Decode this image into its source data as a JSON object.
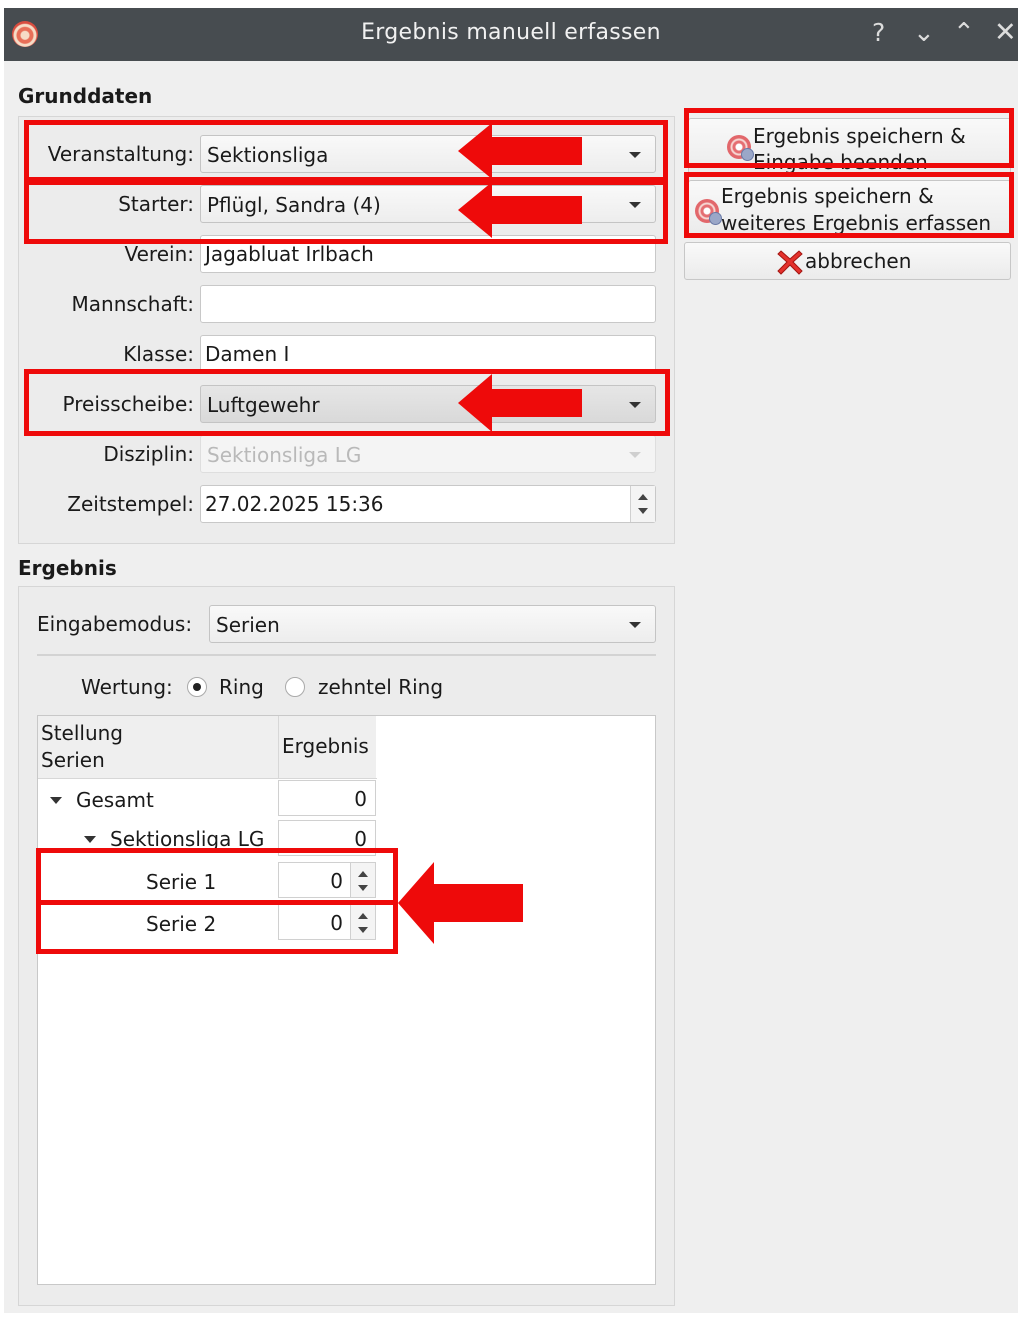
{
  "window": {
    "title": "Ergebnis manuell erfassen",
    "controls": {
      "help": "?",
      "minimize": "⌄",
      "maximize": "⌃",
      "close": "✕"
    }
  },
  "grunddaten": {
    "section_title": "Grunddaten",
    "veranstaltung": {
      "label": "Veranstaltung:",
      "value": "Sektionsliga"
    },
    "starter": {
      "label": "Starter:",
      "value": "Pflügl, Sandra (4)"
    },
    "verein": {
      "label": "Verein:",
      "value": "Jagabluat Irlbach"
    },
    "mannschaft": {
      "label": "Mannschaft:",
      "value": ""
    },
    "klasse": {
      "label": "Klasse:",
      "value": "Damen I"
    },
    "preisscheibe": {
      "label": "Preisscheibe:",
      "value": "Luftgewehr"
    },
    "disziplin": {
      "label": "Disziplin:",
      "value": "Sektionsliga LG"
    },
    "zeitstempel": {
      "label": "Zeitstempel:",
      "value": "27.02.2025 15:36"
    }
  },
  "buttons": {
    "save_finish": {
      "line1": "Ergebnis speichern &",
      "line2": "Eingabe beenden"
    },
    "save_next": {
      "line1": "Ergebnis speichern &",
      "line2": "weiteres Ergebnis erfassen"
    },
    "cancel": {
      "label": "abbrechen"
    }
  },
  "ergebnis": {
    "section_title": "Ergebnis",
    "eingabemodus": {
      "label": "Eingabemodus:",
      "value": "Serien"
    },
    "wertung": {
      "label": "Wertung:",
      "options": [
        {
          "label": "Ring",
          "checked": true
        },
        {
          "label": "zehntel Ring",
          "checked": false
        }
      ]
    },
    "tree": {
      "headers": {
        "col1_line1": "Stellung",
        "col1_line2": "Serien",
        "col2": "Ergebnis"
      },
      "rows": [
        {
          "label": "Gesamt",
          "value": "0"
        },
        {
          "label": "Sektionsliga LG",
          "value": "0"
        },
        {
          "label": "Serie 1",
          "value": "0"
        },
        {
          "label": "Serie 2",
          "value": "0"
        }
      ]
    }
  },
  "colors": {
    "highlight": "#ee0a0a",
    "titlebar": "#474c50",
    "window_bg": "#efefef"
  }
}
